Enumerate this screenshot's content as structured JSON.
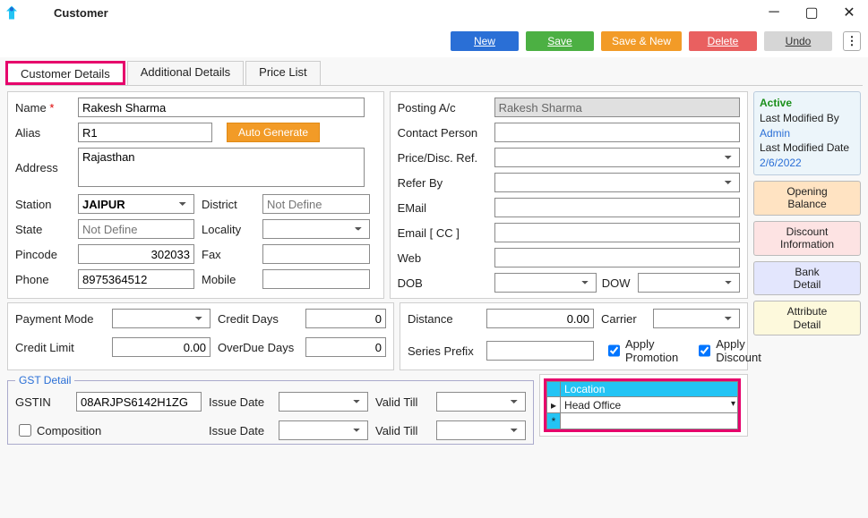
{
  "window": {
    "title": "Customer"
  },
  "actions": {
    "new": "New",
    "save": "Save",
    "savenew": "Save & New",
    "delete": "Delete",
    "undo": "Undo"
  },
  "tabs": {
    "details": "Customer Details",
    "additional": "Additional Details",
    "pricelist": "Price List"
  },
  "status": {
    "active": "Active",
    "lmb_label": "Last Modified By",
    "lmb_value": "Admin",
    "lmd_label": "Last Modified Date",
    "lmd_value": "2/6/2022"
  },
  "sidebtns": {
    "opening": "Opening\nBalance",
    "discount": "Discount\nInformation",
    "bank": "Bank\nDetail",
    "attr": "Attribute\nDetail"
  },
  "fields": {
    "name_label": "Name",
    "name": "Rakesh Sharma",
    "alias_label": "Alias",
    "alias": "R1",
    "autogen": "Auto Generate",
    "address_label": "Address",
    "address": "Rajasthan",
    "station_label": "Station",
    "station": "JAIPUR",
    "district_label": "District",
    "district_ph": "Not Define",
    "state_label": "State",
    "state_ph": "Not Define",
    "locality_label": "Locality",
    "pincode_label": "Pincode",
    "pincode": "302033",
    "fax_label": "Fax",
    "phone_label": "Phone",
    "phone": "8975364512",
    "mobile_label": "Mobile",
    "posting_label": "Posting A/c",
    "posting": "Rakesh Sharma",
    "contact_label": "Contact Person",
    "priceref_label": "Price/Disc. Ref.",
    "referby_label": "Refer By",
    "email_label": "EMail",
    "emailcc_label": "Email [ CC ]",
    "web_label": "Web",
    "dob_label": "DOB",
    "dow_label": "DOW"
  },
  "payment": {
    "mode_label": "Payment Mode",
    "creditdays_label": "Credit Days",
    "creditdays": "0",
    "creditlimit_label": "Credit Limit",
    "creditlimit": "0.00",
    "overdue_label": "OverDue Days",
    "overdue": "0"
  },
  "shipping": {
    "distance_label": "Distance",
    "distance": "0.00",
    "carrier_label": "Carrier",
    "prefix_label": "Series Prefix",
    "apply_promo": "Apply Promotion",
    "apply_disc": "Apply Discount"
  },
  "gst": {
    "legend": "GST Detail",
    "gstin_label": "GSTIN",
    "gstin": "08ARJPS6142H1ZG",
    "issue_label": "Issue Date",
    "valid_label": "Valid Till",
    "composition_label": "Composition"
  },
  "location": {
    "header": "Location",
    "rows": [
      {
        "value": "Head Office"
      }
    ]
  }
}
